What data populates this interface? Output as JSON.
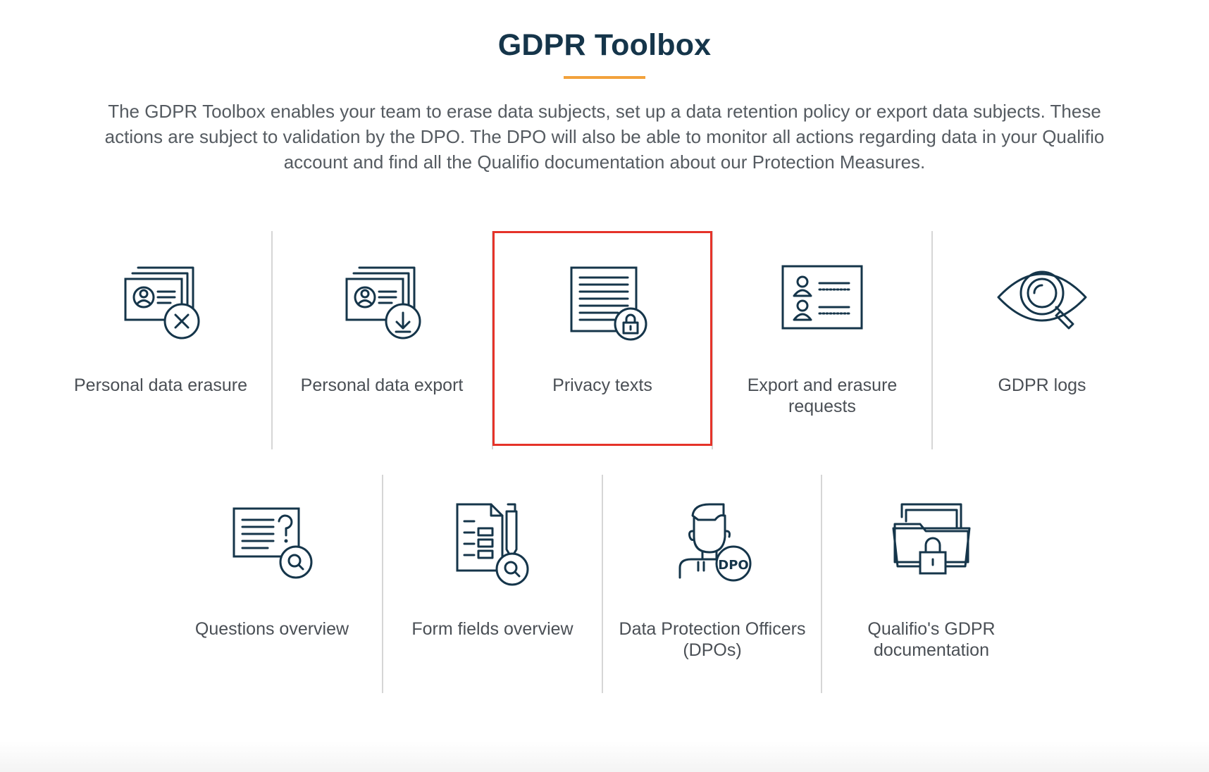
{
  "header": {
    "title": "GDPR Toolbox",
    "description": "The GDPR Toolbox enables your team to erase data subjects, set up a data retention policy or export data subjects. These actions are subject to validation by the DPO. The DPO will also be able to monitor all actions regarding data in your Qualifio account and find all the Qualifio documentation about our Protection Measures."
  },
  "colors": {
    "title": "#15354a",
    "accent_underline": "#f2a23c",
    "selection_border": "#e53329",
    "divider": "#d6d6d6",
    "icon_stroke": "#15354a",
    "text": "#4a4f55"
  },
  "tools": {
    "row1": [
      {
        "label": "Personal data erasure",
        "icon": "id-card-erase-icon"
      },
      {
        "label": "Personal data export",
        "icon": "id-card-download-icon"
      },
      {
        "label": "Privacy texts",
        "icon": "locked-document-icon",
        "selected": true
      },
      {
        "label": "Export and erasure requests",
        "icon": "user-list-card-icon"
      },
      {
        "label": "GDPR logs",
        "icon": "eye-magnifier-icon"
      }
    ],
    "row2": [
      {
        "label": "Questions overview",
        "icon": "question-card-search-icon"
      },
      {
        "label": "Form fields overview",
        "icon": "form-pen-search-icon"
      },
      {
        "label": "Data Protection Officers (DPOs)",
        "icon": "dpo-person-icon",
        "badge": "DPO"
      },
      {
        "label": "Qualifio's GDPR documentation",
        "icon": "locked-folder-icon"
      }
    ]
  }
}
